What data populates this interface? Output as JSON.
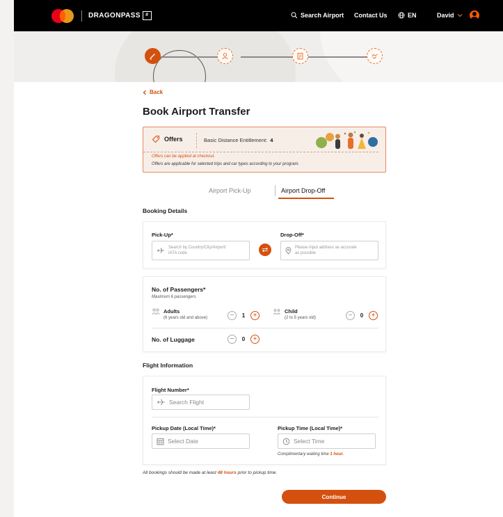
{
  "header": {
    "brand": "DRAGONPASS",
    "brand_mark": "#",
    "search": "Search Airport",
    "contact": "Contact Us",
    "language": "EN",
    "user": "David"
  },
  "steps": [
    {
      "icon": "pencil-icon",
      "state": "active"
    },
    {
      "icon": "user-icon",
      "state": "pending"
    },
    {
      "icon": "document-icon",
      "state": "pending"
    },
    {
      "icon": "handshake-icon",
      "state": "pending"
    }
  ],
  "page": {
    "back": "Back",
    "title": "Book Airport Transfer"
  },
  "offers": {
    "label": "Offers",
    "entitlement_label": "Basic Distance Entitlement:",
    "entitlement_value": "4",
    "note_checkout": "Offers can be applied at checkout.",
    "note_program": "Offers are applicable for selected trips and car types according to your program."
  },
  "tabs": {
    "pickup": "Airport Pick-Up",
    "dropoff": "Airport Drop-Off",
    "active": "dropoff"
  },
  "booking": {
    "heading": "Booking Details",
    "pickup_label": "Pick-Up*",
    "pickup_placeholder_1": "Search by Country/City/Airport/",
    "pickup_placeholder_2": "IATA code",
    "dropoff_label": "Drop-Off*",
    "dropoff_placeholder_1": "Please input address as accurate",
    "dropoff_placeholder_2": "as possible"
  },
  "passengers": {
    "heading": "No. of Passengers*",
    "max": "Maximum 6 passengers",
    "adults_label": "Adults",
    "adults_sub": "(6 years old and above)",
    "adults_value": "1",
    "child_label": "Child",
    "child_sub": "(2 to 5 years old)",
    "child_value": "0",
    "luggage_label": "No. of Luggage",
    "luggage_value": "0"
  },
  "flight": {
    "heading": "Flight Information",
    "number_label": "Flight Number*",
    "number_placeholder": "Search Flight",
    "date_label": "Pickup Date (Local Time)*",
    "date_placeholder": "Select Date",
    "time_label": "Pickup Time (Local Time)*",
    "time_placeholder": "Select Time",
    "waiting_prefix": "Complimentary waiting time",
    "waiting_value": "1 hour."
  },
  "footer": {
    "note_prefix": "All bookings should be made at least",
    "note_hours": "48 hours",
    "note_suffix": "prior to pickup time.",
    "continue": "Continue"
  },
  "colors": {
    "accent": "#d4500f",
    "header_bg": "#000000",
    "offers_bg": "#f7eee8"
  }
}
